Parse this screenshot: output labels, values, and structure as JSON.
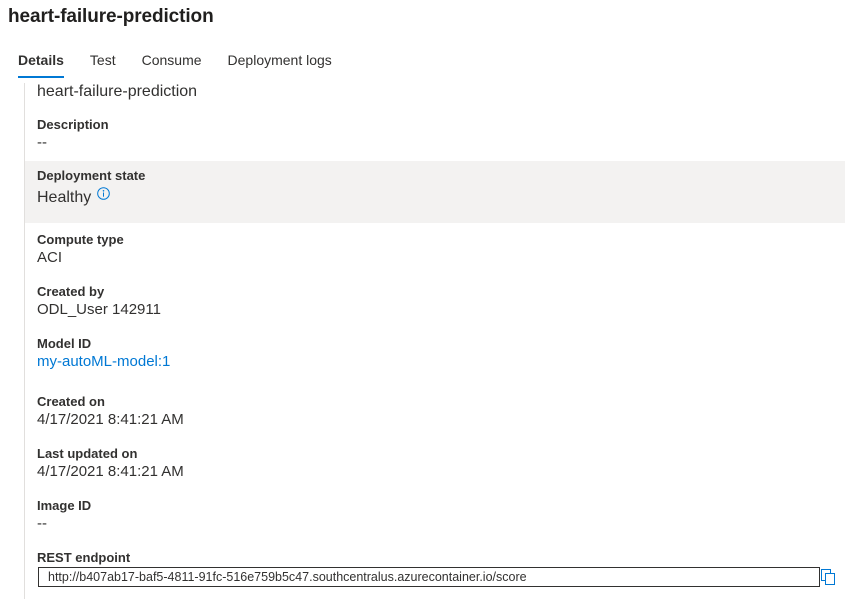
{
  "header": {
    "title": "heart-failure-prediction"
  },
  "tabs": [
    {
      "label": "Details"
    },
    {
      "label": "Test"
    },
    {
      "label": "Consume"
    },
    {
      "label": "Deployment logs"
    }
  ],
  "details": {
    "name": "heart-failure-prediction",
    "description": {
      "label": "Description",
      "value": "--"
    },
    "deployment_state": {
      "label": "Deployment state",
      "value": "Healthy",
      "icon": "info-icon"
    },
    "compute_type": {
      "label": "Compute type",
      "value": "ACI"
    },
    "created_by": {
      "label": "Created by",
      "value": "ODL_User 142911"
    },
    "model_id": {
      "label": "Model ID",
      "value": "my-autoML-model:1"
    },
    "created_on": {
      "label": "Created on",
      "value": "4/17/2021 8:41:21 AM"
    },
    "last_updated_on": {
      "label": "Last updated on",
      "value": "4/17/2021 8:41:21 AM"
    },
    "image_id": {
      "label": "Image ID",
      "value": "--"
    },
    "rest_endpoint": {
      "label": "REST endpoint",
      "value": "http://b407ab17-baf5-4811-91fc-516e759b5c47.southcentralus.azurecontainer.io/score",
      "icon": "copy-icon"
    }
  },
  "colors": {
    "accent": "#0078d4",
    "shaded_row": "#f3f2f1"
  }
}
